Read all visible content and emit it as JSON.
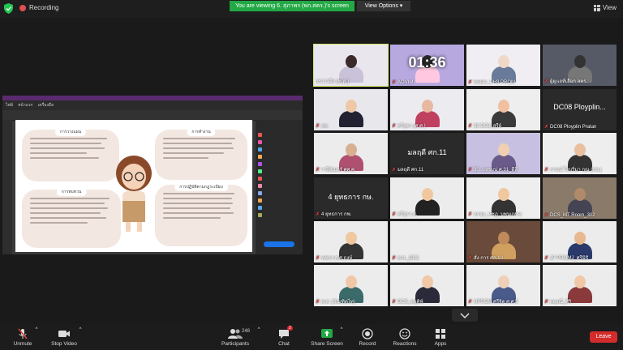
{
  "topbar": {
    "recording_label": "Recording",
    "viewing_banner": "You are viewing 6. สุภาพร (พก.สคร.)'s screen",
    "view_options_label": "View Options",
    "view_label": "View"
  },
  "colors": {
    "banner_green": "#22a845",
    "leave_red": "#d42b2b",
    "active_speaker": "#d6e86a",
    "muted_red": "#e04040"
  },
  "gallery": {
    "tiles": [
      {
        "name": "กราวาอิก (พ.ศ.)",
        "muted": false
      },
      {
        "name": "AOVIM",
        "muted": true,
        "timer": "01:36"
      },
      {
        "name": "SSDA_PH3 PROM",
        "muted": true
      },
      {
        "name": "ผู้ดูแลที่เลือก สคร.",
        "muted": true
      },
      {
        "name": "อพ.",
        "muted": true
      },
      {
        "name": "ศรีสุดา (ศ.ศ.)",
        "muted": true
      },
      {
        "name": "32 DC8_สุรีย์",
        "muted": true
      },
      {
        "name": "DC08 Ployplin Pratan",
        "muted": true,
        "big": "DC08 Ployplin..."
      },
      {
        "name": "ฯ ซีพ์เมลรั ศศ.ศ.",
        "muted": true
      },
      {
        "name": "มลฤดี ศก.11",
        "muted": true,
        "big": "มลฤดี ศก.11"
      },
      {
        "name": "30. มทรมน่ ศ.31_ดีลี",
        "muted": true
      },
      {
        "name": "กานน์ ใจบริ่มา กุณ (กพ.)",
        "muted": true
      },
      {
        "name": "4 ยุทธการ กพ.",
        "muted": true,
        "big": "4 ยุทธการ กษ."
      },
      {
        "name": "ศรีสุรา ศ.",
        "muted": true
      },
      {
        "name": "อรจุม_ทชฎ_บพนแหร่ง",
        "muted": true
      },
      {
        "name": "DCS_MT Room_302",
        "muted": true
      },
      {
        "name": "ทชกร ศ.ศ.ธงษ์",
        "muted": true
      },
      {
        "name": "ศ.ศ._DC2",
        "muted": true
      },
      {
        "name": "สั่ง การ ศก.10",
        "muted": true
      },
      {
        "name": "27 PROMJ_ศรีมิธิ",
        "muted": true
      },
      {
        "name": "ศ.ศ. (บัณฑิตไท)",
        "muted": true
      },
      {
        "name": "DCS_พลุติพ์",
        "muted": true
      },
      {
        "name": "UPROM ศรีจิต ศ.ศ.5",
        "muted": true
      },
      {
        "name": "ผดุงณี_ศิริ",
        "muted": true
      }
    ]
  },
  "shared_doc": {
    "menu": [
      "ไฟล์",
      "หน้าแรก",
      "เครื่องมือ"
    ],
    "cards": [
      {
        "heading": "การวางแผน"
      },
      {
        "heading": "การทำงาน"
      },
      {
        "heading": "การทบทวน"
      },
      {
        "heading": "การปฏิบัติตามกฎระเบียบ"
      }
    ]
  },
  "toolbar": {
    "unmute": "Unmute",
    "stop_video": "Stop Video",
    "participants": "Participants",
    "participants_count": "248",
    "chat": "Chat",
    "chat_badge": "2",
    "share_screen": "Share Screen",
    "record": "Record",
    "reactions": "Reactions",
    "apps": "Apps",
    "leave": "Leave"
  }
}
